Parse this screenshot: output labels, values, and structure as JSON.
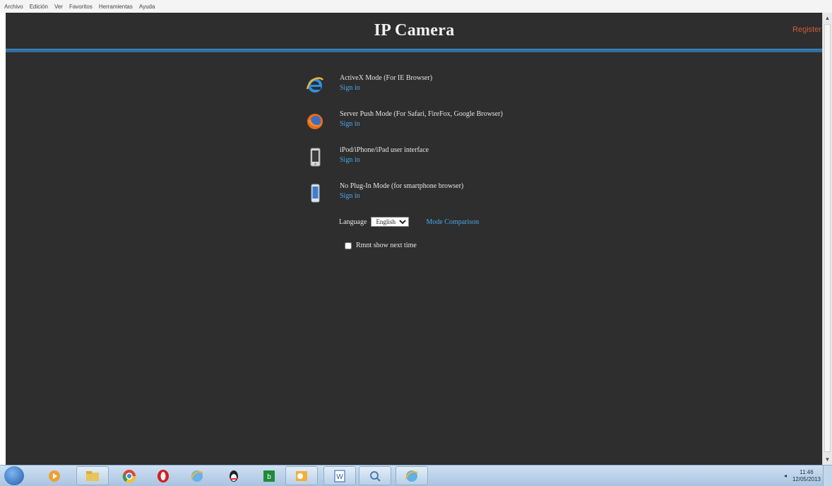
{
  "browser": {
    "menu": [
      "Archivo",
      "Edición",
      "Ver",
      "Favoritos",
      "Herramientas",
      "Ayuda"
    ]
  },
  "header": {
    "title": "IP Camera",
    "corner_link": "Register"
  },
  "options": [
    {
      "label": "ActiveX Mode (For IE Browser)",
      "link": "Sign in",
      "icon": "ie-icon"
    },
    {
      "label": "Server Push Mode (For Safari, FireFox, Google Browser)",
      "link": "Sign in",
      "icon": "firefox-icon"
    },
    {
      "label": "iPod/iPhone/iPad user interface",
      "link": "Sign in",
      "icon": "ipod-icon"
    },
    {
      "label": "No Plug-In Mode (for smartphone browser)",
      "link": "Sign in",
      "icon": "smartphone-icon"
    }
  ],
  "language": {
    "label": "Language",
    "selected": "English",
    "mode_link": "Mode Comparison"
  },
  "remember": {
    "label": "Rmnt show next time"
  },
  "taskbar": {
    "clock_time": "11:46",
    "clock_date": "12/05/2013"
  }
}
